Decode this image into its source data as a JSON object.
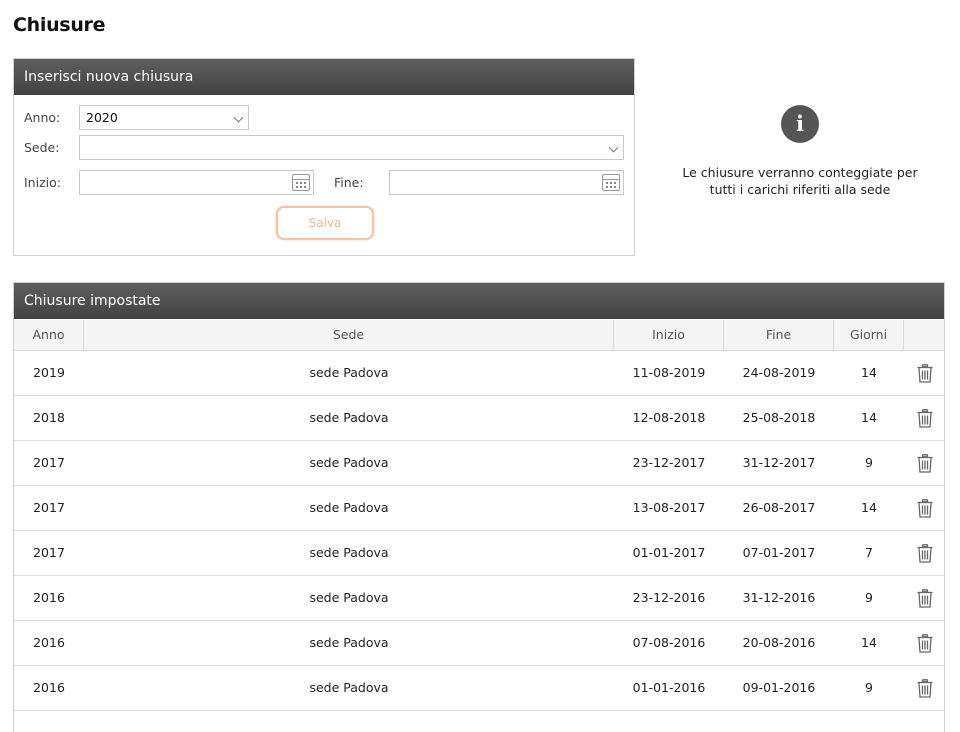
{
  "page": {
    "title": "Chiusure"
  },
  "insert_form": {
    "header": "Inserisci nuova chiusura",
    "anno_label": "Anno:",
    "anno_value": "2020",
    "sede_label": "Sede:",
    "sede_value": "",
    "inizio_label": "Inizio:",
    "inizio_value": "",
    "fine_label": "Fine:",
    "fine_value": "",
    "save_label": "Salva"
  },
  "info": {
    "icon": "info-icon",
    "text": "Le chiusure verranno conteggiate per tutti i carichi riferiti alla sede"
  },
  "table": {
    "header": "Chiusure impostate",
    "columns": [
      "Anno",
      "Sede",
      "Inizio",
      "Fine",
      "Giorni",
      ""
    ],
    "rows": [
      {
        "anno": "2019",
        "sede": "sede Padova",
        "inizio": "11-08-2019",
        "fine": "24-08-2019",
        "giorni": "14"
      },
      {
        "anno": "2018",
        "sede": "sede Padova",
        "inizio": "12-08-2018",
        "fine": "25-08-2018",
        "giorni": "14"
      },
      {
        "anno": "2017",
        "sede": "sede Padova",
        "inizio": "23-12-2017",
        "fine": "31-12-2017",
        "giorni": "9"
      },
      {
        "anno": "2017",
        "sede": "sede Padova",
        "inizio": "13-08-2017",
        "fine": "26-08-2017",
        "giorni": "14"
      },
      {
        "anno": "2017",
        "sede": "sede Padova",
        "inizio": "01-01-2017",
        "fine": "07-01-2017",
        "giorni": "7"
      },
      {
        "anno": "2016",
        "sede": "sede Padova",
        "inizio": "23-12-2016",
        "fine": "31-12-2016",
        "giorni": "9"
      },
      {
        "anno": "2016",
        "sede": "sede Padova",
        "inizio": "07-08-2016",
        "fine": "20-08-2016",
        "giorni": "14"
      },
      {
        "anno": "2016",
        "sede": "sede Padova",
        "inizio": "01-01-2016",
        "fine": "09-01-2016",
        "giorni": "9"
      }
    ],
    "row_action_icon": "trash-icon"
  }
}
